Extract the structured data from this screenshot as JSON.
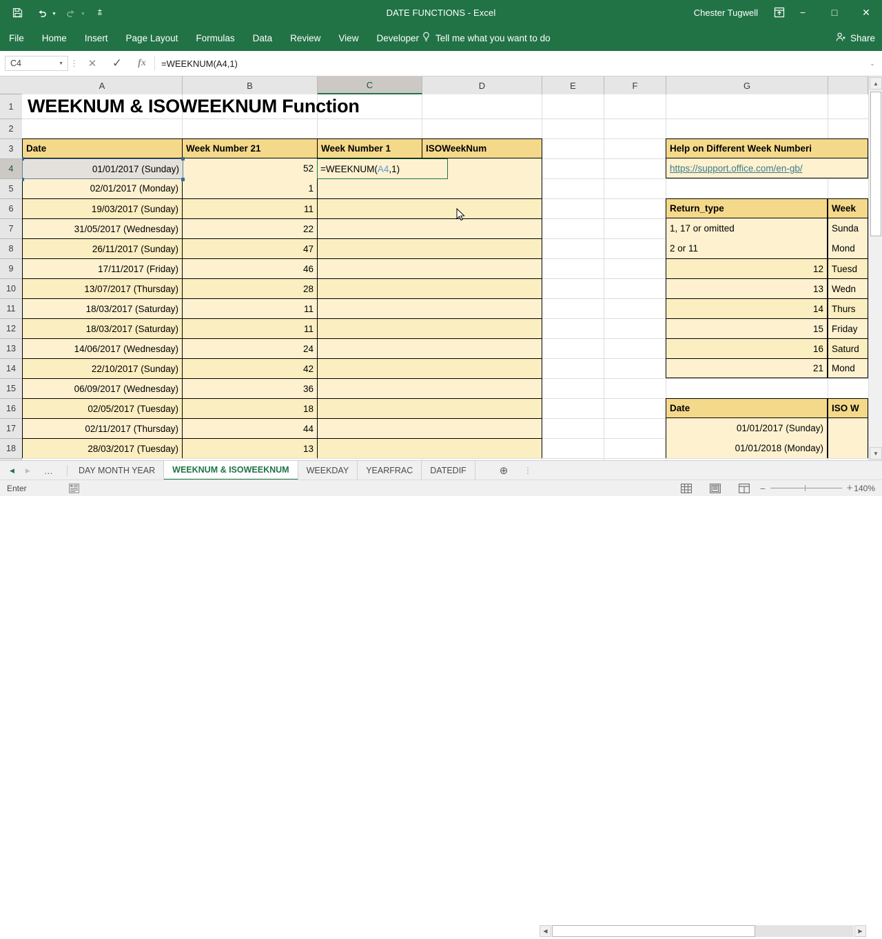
{
  "titlebar": {
    "document_title": "DATE FUNCTIONS - Excel",
    "user_name": "Chester Tugwell",
    "qat": [
      {
        "name": "save-icon",
        "glyph": "💾"
      },
      {
        "name": "undo-icon",
        "glyph": "↶"
      },
      {
        "name": "redo-icon",
        "glyph": "↷"
      },
      {
        "name": "customize-qat-icon",
        "glyph": "≡"
      }
    ],
    "ribbon_display_options": "⤓",
    "minimize": "−",
    "maximize": "□",
    "close": "✕"
  },
  "ribbon": {
    "tabs": [
      {
        "label": "File"
      },
      {
        "label": "Home"
      },
      {
        "label": "Insert"
      },
      {
        "label": "Page Layout"
      },
      {
        "label": "Formulas"
      },
      {
        "label": "Data"
      },
      {
        "label": "Review"
      },
      {
        "label": "View"
      },
      {
        "label": "Developer"
      }
    ],
    "tell_me": "Tell me what you want to do",
    "share": "Share"
  },
  "formula_bar": {
    "name_box": "C4",
    "cancel": "✕",
    "enter": "✓",
    "insert_function": "fx",
    "formula": "=WEEKNUM(A4,1)",
    "expand": "⌄"
  },
  "grid": {
    "columns": [
      {
        "label": "A"
      },
      {
        "label": "B"
      },
      {
        "label": "C"
      },
      {
        "label": "D"
      },
      {
        "label": "E"
      },
      {
        "label": "F"
      },
      {
        "label": "G"
      }
    ],
    "selected_column": "C",
    "rows": [
      "1",
      "2",
      "3",
      "4",
      "5",
      "6",
      "7",
      "8",
      "9",
      "10",
      "11",
      "12",
      "13",
      "14",
      "15",
      "16",
      "17",
      "18"
    ],
    "selected_row": "4",
    "title_cell": "WEEKNUM & ISOWEEKNUM Function",
    "headers": {
      "date": "Date",
      "week_number_21": "Week Number 21",
      "week_number_1": "Week Number 1",
      "isoweeknum": "ISOWeekNum"
    },
    "active_cell": {
      "address": "C4",
      "editing_text": "=WEEKNUM(",
      "ref_text": "A4",
      "tail_text": ",1)"
    },
    "table_rows": [
      {
        "row": "4",
        "date": "01/01/2017 (Sunday)",
        "week21": "52"
      },
      {
        "row": "5",
        "date": "02/01/2017 (Monday)",
        "week21": "1"
      },
      {
        "row": "6",
        "date": "19/03/2017 (Sunday)",
        "week21": "11"
      },
      {
        "row": "7",
        "date": "31/05/2017 (Wednesday)",
        "week21": "22"
      },
      {
        "row": "8",
        "date": "26/11/2017 (Sunday)",
        "week21": "47"
      },
      {
        "row": "9",
        "date": "17/11/2017 (Friday)",
        "week21": "46"
      },
      {
        "row": "10",
        "date": "13/07/2017 (Thursday)",
        "week21": "28"
      },
      {
        "row": "11",
        "date": "18/03/2017 (Saturday)",
        "week21": "11"
      },
      {
        "row": "12",
        "date": "18/03/2017 (Saturday)",
        "week21": "11"
      },
      {
        "row": "13",
        "date": "14/06/2017 (Wednesday)",
        "week21": "24"
      },
      {
        "row": "14",
        "date": "22/10/2017 (Sunday)",
        "week21": "42"
      },
      {
        "row": "15",
        "date": "06/09/2017 (Wednesday)",
        "week21": "36"
      },
      {
        "row": "16",
        "date": "02/05/2017 (Tuesday)",
        "week21": "18"
      },
      {
        "row": "17",
        "date": "02/11/2017 (Thursday)",
        "week21": "44"
      },
      {
        "row": "18",
        "date": "28/03/2017 (Tuesday)",
        "week21": "13"
      }
    ],
    "help_panel": {
      "title": "Help on Different Week Numberi",
      "link": "https://support.office.com/en-gb/",
      "return_type_header": "Return_type",
      "week_header": "Week",
      "return_type_rows": [
        {
          "type": "1, 17 or omitted",
          "day": "Sunda"
        },
        {
          "type": "2 or 11",
          "day": "Mond"
        },
        {
          "type": "12",
          "day": "Tuesd"
        },
        {
          "type": "13",
          "day": "Wedn"
        },
        {
          "type": "14",
          "day": "Thurs"
        },
        {
          "type": "15",
          "day": "Friday"
        },
        {
          "type": "16",
          "day": "Saturd"
        },
        {
          "type": "21",
          "day": "Mond"
        }
      ],
      "iso_date_header": "Date",
      "iso_week_header": "ISO W",
      "iso_rows": [
        {
          "date": "01/01/2017 (Sunday)"
        },
        {
          "date": "01/01/2018 (Monday)"
        }
      ]
    }
  },
  "sheet_bar": {
    "nav_first": "◀",
    "nav_prev": "▶",
    "ellipsis": "…",
    "tabs": [
      {
        "label": "DAY MONTH YEAR",
        "active": false
      },
      {
        "label": "WEEKNUM & ISOWEEKNUM",
        "active": true
      },
      {
        "label": "WEEKDAY",
        "active": false
      },
      {
        "label": "YEARFRAC",
        "active": false
      },
      {
        "label": "DATEDIF",
        "active": false
      }
    ],
    "add_sheet": "⊕",
    "overflow": "⋮"
  },
  "status_bar": {
    "mode": "Enter",
    "view_normal": "normal-view-icon",
    "view_page_layout": "page-layout-view-icon",
    "view_page_break": "page-break-view-icon",
    "zoom_out": "−",
    "zoom_in": "+",
    "zoom_level": "140%"
  },
  "colors": {
    "brand_green": "#217346",
    "header_fill": "#f5d98b",
    "band_light": "#fdf1d0",
    "band_dark": "#fbeec0",
    "hyperlink": "#3c7c8c",
    "ref_blue": "#5b9bd5"
  }
}
